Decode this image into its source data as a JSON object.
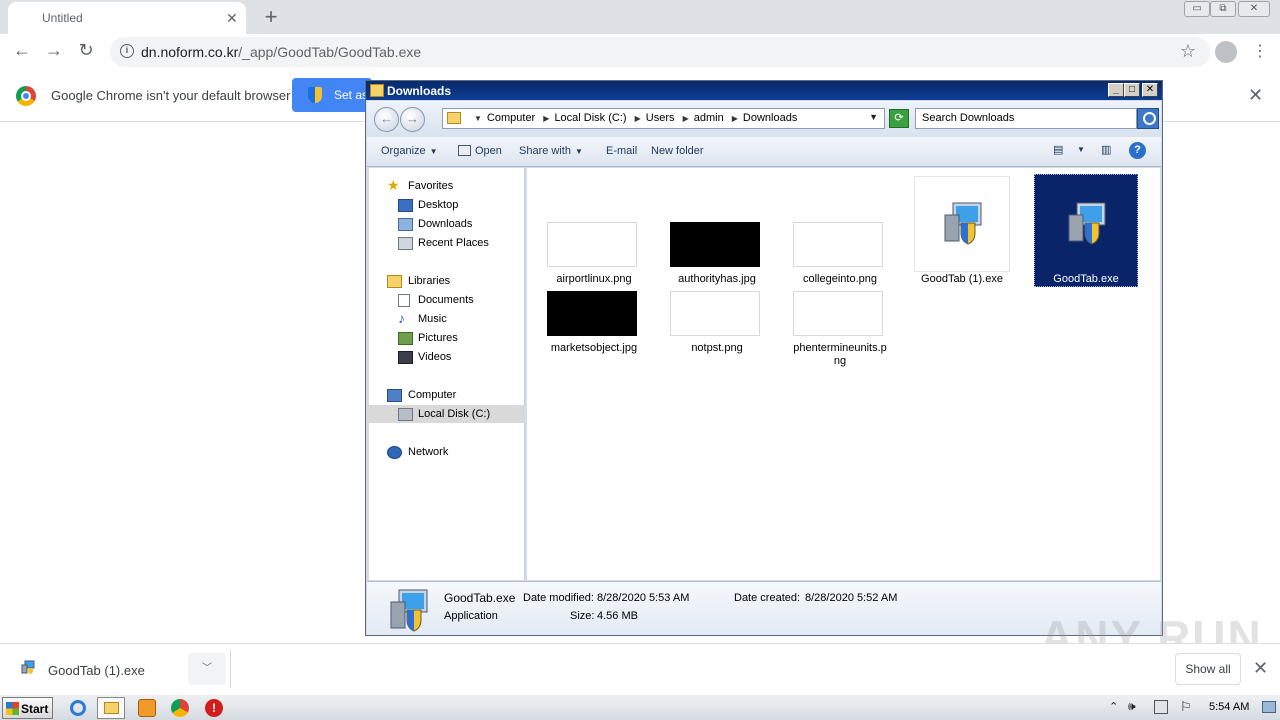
{
  "browser": {
    "tab_title": "Untitled",
    "tab_close": "✕",
    "new_tab": "+",
    "window_buttons": [
      "▭",
      "⧉",
      "✕"
    ],
    "url_domain": "dn.noform.co.kr",
    "url_path": "/_app/GoodTab/GoodTab.exe",
    "icons": [
      "back-icon",
      "forward-icon",
      "reload-icon",
      "info-icon",
      "star-icon",
      "account-icon",
      "menu-icon"
    ]
  },
  "infobar": {
    "message": "Google Chrome isn't your default browser",
    "button_label": "Set as"
  },
  "explorer": {
    "title": "Downloads",
    "breadcrumb": [
      "Computer",
      "Local Disk (C:)",
      "Users",
      "admin",
      "Downloads"
    ],
    "search_placeholder": "Search Downloads",
    "commands": {
      "organize": "Organize",
      "open": "Open",
      "share_with": "Share with",
      "email": "E-mail",
      "new_folder": "New folder"
    },
    "nav": {
      "favorites": "Favorites",
      "desktop": "Desktop",
      "downloads": "Downloads",
      "recent_places": "Recent Places",
      "libraries": "Libraries",
      "documents": "Documents",
      "music": "Music",
      "pictures": "Pictures",
      "videos": "Videos",
      "computer": "Computer",
      "local_disk": "Local Disk (C:)",
      "network": "Network"
    },
    "files": [
      {
        "name": "airportlinux.png",
        "thumb": "white"
      },
      {
        "name": "authorityhas.jpg",
        "thumb": "black"
      },
      {
        "name": "collegeinto.png",
        "thumb": "white"
      },
      {
        "name": "GoodTab (1).exe",
        "thumb": "exe"
      },
      {
        "name": "GoodTab.exe",
        "thumb": "exe",
        "selected": true
      },
      {
        "name": "marketsobject.jpg",
        "thumb": "black"
      },
      {
        "name": "notpst.png",
        "thumb": "white"
      },
      {
        "name": "phentermineunits.p",
        "name2": "ng",
        "thumb": "white"
      }
    ],
    "details": {
      "name": "GoodTab.exe",
      "type": "Application",
      "modified_label": "Date modified:",
      "modified": "8/28/2020 5:53 AM",
      "created_label": "Date created:",
      "created": "8/28/2020 5:52 AM",
      "size_label": "Size:",
      "size": "4.56 MB"
    }
  },
  "shelf": {
    "download_name": "GoodTab (1).exe",
    "show_all": "Show all"
  },
  "watermark": "ANY RUN",
  "taskbar": {
    "start": "Start",
    "time": "5:54 AM"
  },
  "colors": {
    "chrome_blue": "#4285f4",
    "explorer_title": "#0a246a",
    "selection": "#0a246a"
  }
}
